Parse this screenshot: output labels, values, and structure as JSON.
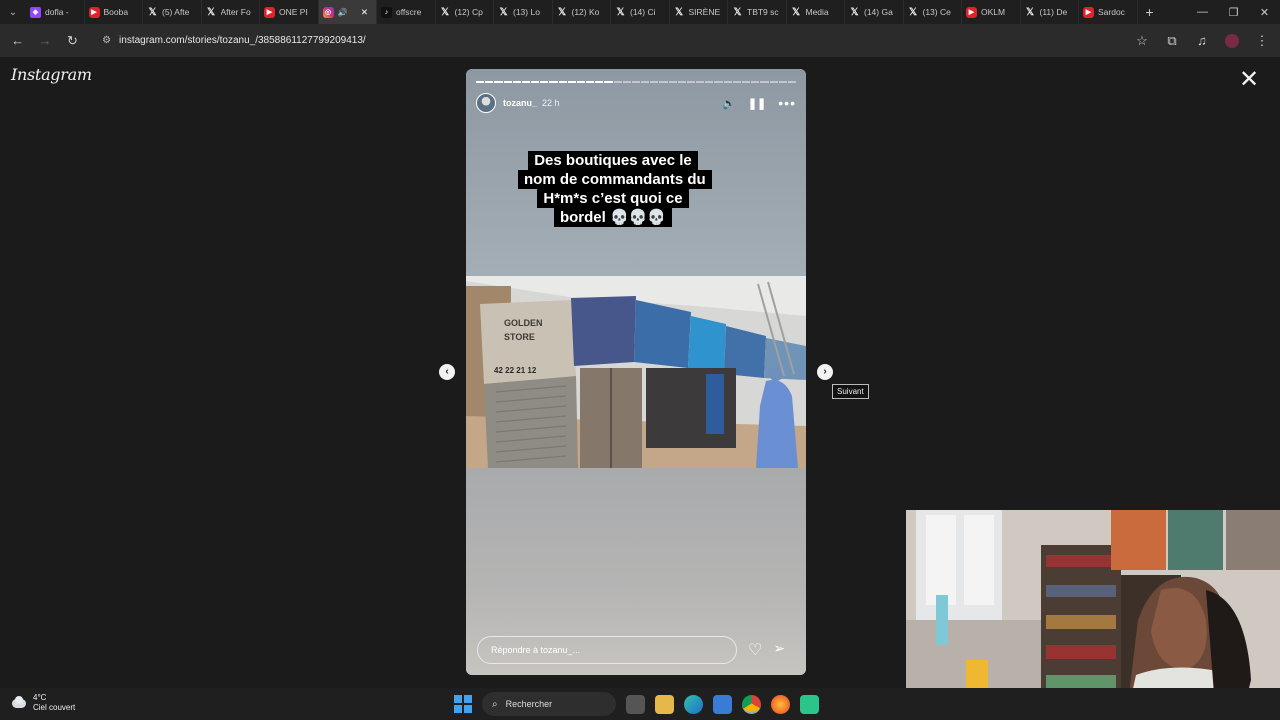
{
  "browser": {
    "tabs": [
      {
        "favicon": "twitch-icon",
        "label": "dofla -"
      },
      {
        "favicon": "youtube-icon",
        "label": "Booba"
      },
      {
        "favicon": "x-icon",
        "label": "(5) Afte"
      },
      {
        "favicon": "x-icon",
        "label": "After Fo"
      },
      {
        "favicon": "youtube-icon",
        "label": "ONE PI"
      },
      {
        "favicon": "instagram-icon",
        "label": "",
        "active": true
      },
      {
        "favicon": "tiktok-icon",
        "label": "offscre"
      },
      {
        "favicon": "x-icon",
        "label": "(12) Cp"
      },
      {
        "favicon": "x-icon",
        "label": "(13) Lo"
      },
      {
        "favicon": "x-icon",
        "label": "(12) Ko"
      },
      {
        "favicon": "x-icon",
        "label": "(14) Ci"
      },
      {
        "favicon": "x-icon",
        "label": "SIRÈNE"
      },
      {
        "favicon": "x-icon",
        "label": "TBT9 sc"
      },
      {
        "favicon": "x-icon",
        "label": "Media"
      },
      {
        "favicon": "x-icon",
        "label": "(14) Ga"
      },
      {
        "favicon": "x-icon",
        "label": "(13) Ce"
      },
      {
        "favicon": "youtube-icon",
        "label": "OKLM"
      },
      {
        "favicon": "x-icon",
        "label": "(11) De"
      },
      {
        "favicon": "youtube-icon",
        "label": "Sardoc"
      }
    ],
    "url": "instagram.com/stories/tozanu_/3858861127799209413/"
  },
  "instagram": {
    "logo": "Instagram",
    "story": {
      "username": "tozanu_",
      "time_ago": "22 h",
      "caption": "Des boutiques avec le nom de commandants du H*m*s c’est quoi ce bordel 💀💀💀",
      "photo_signs": {
        "golden_store": [
          "GOLDEN",
          "STORE"
        ],
        "phone": "42 22 21 12"
      },
      "reply_placeholder": "Répondre à tozanu_...",
      "progress_segments": 35,
      "progress_done": 15
    },
    "next_tooltip": "Suivant"
  },
  "taskbar": {
    "weather_temp": "4°C",
    "weather_desc": "Ciel couvert",
    "search_label": "Rechercher"
  },
  "colors": {
    "accent_windows": "#3fa3f1",
    "story_sky": "#9aa4ac"
  }
}
